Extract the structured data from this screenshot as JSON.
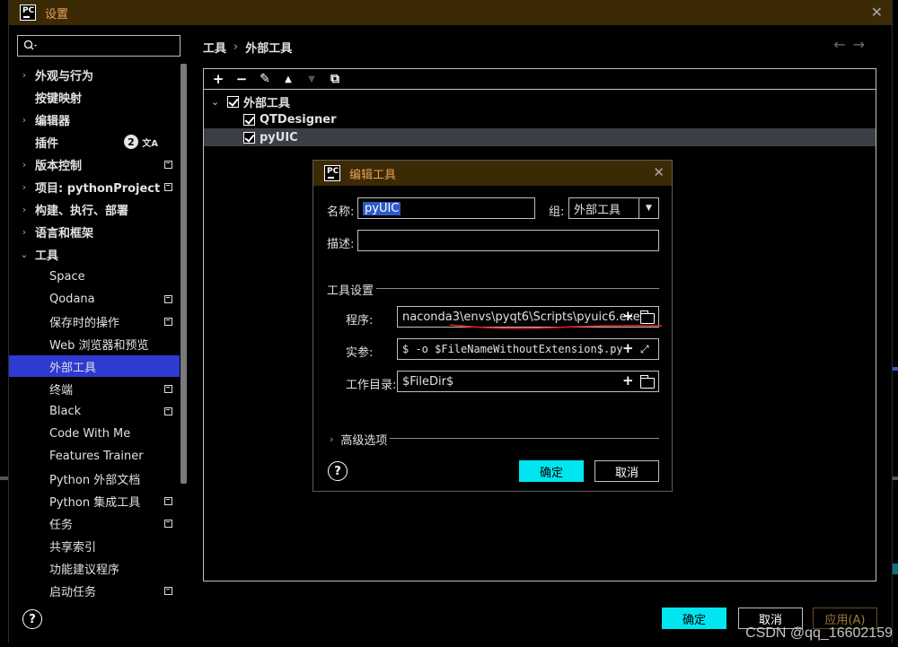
{
  "window": {
    "logo": "PC",
    "title": "设置",
    "close_icon": "close-icon"
  },
  "search": {
    "placeholder": "",
    "icon": "search-icon"
  },
  "sidebar": {
    "items": [
      {
        "label": "外观与行为",
        "bold": true,
        "expandable": true,
        "level": 0
      },
      {
        "label": "按键映射",
        "bold": true,
        "expandable": false,
        "level": 0
      },
      {
        "label": "编辑器",
        "bold": true,
        "expandable": true,
        "level": 0
      },
      {
        "label": "插件",
        "bold": true,
        "expandable": false,
        "level": 0,
        "badge": "2"
      },
      {
        "label": "版本控制",
        "bold": true,
        "expandable": true,
        "level": 0,
        "mark": true
      },
      {
        "label": "项目: pythonProject",
        "bold": true,
        "expandable": true,
        "level": 0,
        "mark": true
      },
      {
        "label": "构建、执行、部署",
        "bold": true,
        "expandable": true,
        "level": 0
      },
      {
        "label": "语言和框架",
        "bold": true,
        "expandable": true,
        "level": 0
      },
      {
        "label": "工具",
        "bold": true,
        "expandable": true,
        "expanded": true,
        "level": 0
      },
      {
        "label": "Space",
        "level": 1
      },
      {
        "label": "Qodana",
        "level": 1,
        "mark": true
      },
      {
        "label": "保存时的操作",
        "level": 1,
        "mark": true
      },
      {
        "label": "Web 浏览器和预览",
        "level": 1
      },
      {
        "label": "外部工具",
        "level": 1,
        "selected": true
      },
      {
        "label": "终端",
        "level": 1,
        "mark": true
      },
      {
        "label": "Black",
        "level": 1,
        "mark": true
      },
      {
        "label": "Code With Me",
        "level": 1
      },
      {
        "label": "Features Trainer",
        "level": 1
      },
      {
        "label": "Python 外部文档",
        "level": 1
      },
      {
        "label": "Python 集成工具",
        "level": 1,
        "mark": true
      },
      {
        "label": "任务",
        "level": 1,
        "expandable": true,
        "mark": true
      },
      {
        "label": "共享索引",
        "level": 1
      },
      {
        "label": "功能建议程序",
        "level": 1
      },
      {
        "label": "启动任务",
        "level": 1,
        "mark": true
      }
    ]
  },
  "breadcrumb": {
    "parent": "工具",
    "separator": "›",
    "current": "外部工具"
  },
  "nav": {
    "back": "←",
    "forward": "→"
  },
  "toolbar": {
    "add": "+",
    "remove": "−",
    "edit": "✎",
    "up": "▲",
    "down": "▼",
    "copy": "⧉"
  },
  "tools_tree": {
    "group": "外部工具",
    "items": [
      "QTDesigner",
      "pyUIC"
    ],
    "selected": "pyUIC"
  },
  "dialog": {
    "logo": "PC",
    "title": "编辑工具",
    "name_label": "名称:",
    "name_value": "pyUIC",
    "group_label": "组:",
    "group_value": "外部工具",
    "desc_label": "描述:",
    "desc_value": "",
    "tool_settings": "工具设置",
    "program_label": "程序:",
    "program_value": "naconda3\\envs\\pyqt6\\Scripts\\pyuic6.exe",
    "args_label": "实参:",
    "args_value": "$ -o $FileNameWithoutExtension$.py",
    "workdir_label": "工作目录:",
    "workdir_value": "$FileDir$",
    "advanced": "高级选项",
    "ok": "确定",
    "cancel": "取消",
    "help": "?"
  },
  "footer": {
    "help": "?",
    "ok": "确定",
    "cancel": "取消",
    "apply": "应用(A)"
  },
  "watermark": "CSDN @qq_16602159",
  "colors": {
    "title_bar": "#3c2a05",
    "title_text": "#e8a15a",
    "selection": "#2e3ad1",
    "primary_button": "#00e5f0"
  }
}
